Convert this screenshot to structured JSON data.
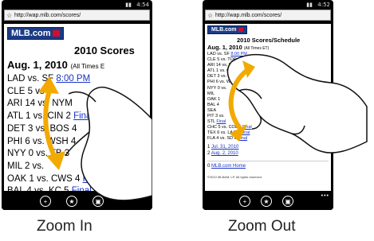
{
  "status": {
    "time_left": "4:54",
    "time_right": "4:52"
  },
  "address_bar": {
    "url_left": "http://wap.mlb.com/scores/",
    "url_right": "http://wap.mlb.com/scores/"
  },
  "logo_text": "MLB.com",
  "left_page": {
    "heading": "2010 Scores",
    "date": "Aug. 1, 2010",
    "date_note": "(All Times E",
    "rows": [
      {
        "text": "LAD vs. SF",
        "link": "8:00 PM"
      },
      {
        "text": "CLE 5 vs",
        "link": ""
      },
      {
        "text": "ARI 14 vs. NYM",
        "link": ""
      },
      {
        "text": "ATL 1 vs. CIN 2",
        "link": "Final"
      },
      {
        "text": "DET 3 vs. BOS 4",
        "link": ""
      },
      {
        "text": "PHI 6 vs. WSH 4",
        "link": ""
      },
      {
        "text": "NYY 0 vs. TB 3",
        "link": ""
      },
      {
        "text": "MIL 2 vs.",
        "link": ""
      },
      {
        "text": "OAK 1 vs. CWS 4",
        "link": "Final"
      },
      {
        "text": "BAL 4 vs. KC 5",
        "link": "Final"
      }
    ]
  },
  "right_page": {
    "heading": "2010 Scores/Schedule",
    "date": "Aug. 1, 2010",
    "date_note": "(All Times ET)",
    "rows": [
      {
        "text": "LAD vs. SF",
        "link": "8:00 PM"
      },
      {
        "text": "CLE 5 vs. TOR 4",
        "link": "Final"
      },
      {
        "text": "ARI 14 vs. NYM",
        "link": ""
      },
      {
        "text": "ATL 1 vs. CIN",
        "link": ""
      },
      {
        "text": "DET 3 vs. BOS",
        "link": ""
      },
      {
        "text": "PHI 6 vs. WSH",
        "link": ""
      },
      {
        "text": "NYY 0 vs.",
        "link": ""
      },
      {
        "text": "MIL",
        "link": ""
      },
      {
        "text": "OAK 1",
        "link": ""
      },
      {
        "text": "BAL 4",
        "link": ""
      },
      {
        "text": "SEA",
        "link": ""
      },
      {
        "text": "PIT 3 vs.",
        "link": ""
      },
      {
        "text": "STL",
        "link": "Final"
      },
      {
        "text": "CHC 5 vs. COL 8",
        "link": "Final"
      },
      {
        "text": "TEX 6 vs. LAA 4",
        "link": "Final"
      },
      {
        "text": "FLA 4 vs. SD 6",
        "link": "Final"
      }
    ],
    "date_links": [
      {
        "num": "1",
        "link": "Jul. 31, 2010"
      },
      {
        "num": "2",
        "link": "Aug. 2, 2010"
      }
    ],
    "home_num": "0",
    "home_link": "MLB.com Home",
    "copyright": "©2010 MLBAM, LP. All rights reserved."
  },
  "captions": {
    "left": "Zoom In",
    "right": "Zoom Out"
  }
}
